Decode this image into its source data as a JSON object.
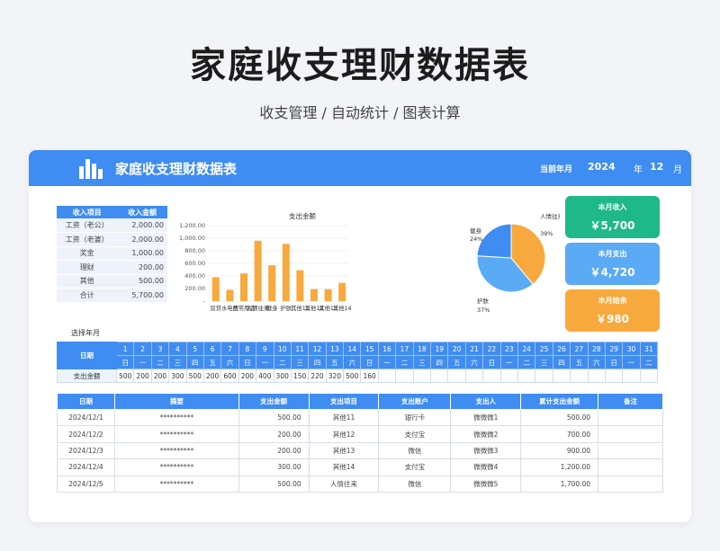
{
  "page": {
    "title": "家庭收支理财数据表",
    "subtitle": "收支管理 / 自动统计 / 图表计算"
  },
  "banner": {
    "title": "家庭收支理财数据表",
    "period_label": "当前年月",
    "year": "2024",
    "year_unit": "年",
    "month": "12",
    "month_unit": "月"
  },
  "income": {
    "headers": [
      "收入项目",
      "收入金额"
    ],
    "rows": [
      {
        "name": "工资（老公）",
        "amount": "2,000.00"
      },
      {
        "name": "工资（老婆）",
        "amount": "2,000.00"
      },
      {
        "name": "奖金",
        "amount": "1,000.00"
      },
      {
        "name": "理财",
        "amount": "200.00"
      },
      {
        "name": "其他",
        "amount": "500.00"
      },
      {
        "name": "合计",
        "amount": "5,700.00"
      }
    ]
  },
  "kpis": [
    {
      "label": "本月收入",
      "value": "￥5,700",
      "color": "#1fb889"
    },
    {
      "label": "本月支出",
      "value": "￥4,720",
      "color": "#5aaaf5"
    },
    {
      "label": "本月结余",
      "value": "￥980",
      "color": "#f8a93d"
    }
  ],
  "charts": {
    "bar_title": "支出金额",
    "bar_color": "#f8a93d",
    "pie_colors": [
      "#f8a93d",
      "#5aaaf5",
      "#3f8cf2"
    ]
  },
  "chart_data": [
    {
      "type": "bar",
      "title": "支出金额",
      "categories": [
        "房贷",
        "水电费",
        "日常用品",
        "人情往来",
        "健身",
        "护肤",
        "其他11",
        "其他12",
        "其他13",
        "其他14"
      ],
      "values": [
        380,
        180,
        440,
        960,
        570,
        910,
        490,
        190,
        190,
        290
      ],
      "ylim": [
        0,
        1200
      ],
      "yticks": [
        "-",
        "200.00",
        "400.00",
        "600.00",
        "800.00",
        "1,000.00",
        "1,200.00"
      ],
      "grid": true
    },
    {
      "type": "pie",
      "slices": [
        {
          "label": "人情往来",
          "pct_label": "39%",
          "value": 39
        },
        {
          "label": "护肤",
          "pct_label": "37%",
          "value": 37
        },
        {
          "label": "健身",
          "pct_label": "24%",
          "value": 24
        }
      ]
    }
  ],
  "calendar": {
    "select_label": "选择年月",
    "date_label": "日期",
    "amount_label": "支出金额",
    "days": [
      "1",
      "2",
      "3",
      "4",
      "5",
      "6",
      "7",
      "8",
      "9",
      "10",
      "11",
      "12",
      "13",
      "14",
      "15",
      "16",
      "17",
      "18",
      "19",
      "20",
      "21",
      "22",
      "23",
      "24",
      "25",
      "26",
      "27",
      "28",
      "29",
      "30",
      "31"
    ],
    "weekdays": [
      "日",
      "一",
      "二",
      "三",
      "四",
      "五",
      "六",
      "日",
      "一",
      "二",
      "三",
      "四",
      "五",
      "六",
      "日",
      "一",
      "二",
      "三",
      "四",
      "五",
      "六",
      "日",
      "一",
      "二",
      "三",
      "四",
      "五",
      "六",
      "日",
      "一",
      "二"
    ],
    "amounts": [
      "500",
      "200",
      "200",
      "300",
      "500",
      "200",
      "600",
      "200",
      "400",
      "300",
      "150",
      "220",
      "320",
      "500",
      "160",
      "",
      "",
      "",
      "",
      "",
      "",
      "",
      "",
      "",
      "",
      "",
      "",
      "",
      "",
      "",
      ""
    ]
  },
  "details": {
    "headers": [
      "日期",
      "摘要",
      "支出金额",
      "支出项目",
      "支出账户",
      "支出人",
      "累计支出金额",
      "备注"
    ],
    "rows": [
      [
        "2024/12/1",
        "**********",
        "500.00",
        "其他11",
        "银行卡",
        "微微微1",
        "500.00",
        ""
      ],
      [
        "2024/12/2",
        "**********",
        "200.00",
        "其他12",
        "支付宝",
        "微微微2",
        "700.00",
        ""
      ],
      [
        "2024/12/3",
        "**********",
        "200.00",
        "其他13",
        "微信",
        "微微微3",
        "900.00",
        ""
      ],
      [
        "2024/12/4",
        "**********",
        "300.00",
        "其他14",
        "支付宝",
        "微微微4",
        "1,200.00",
        ""
      ],
      [
        "2024/12/5",
        "**********",
        "500.00",
        "人情往来",
        "微信",
        "微微微5",
        "1,700.00",
        ""
      ]
    ]
  }
}
